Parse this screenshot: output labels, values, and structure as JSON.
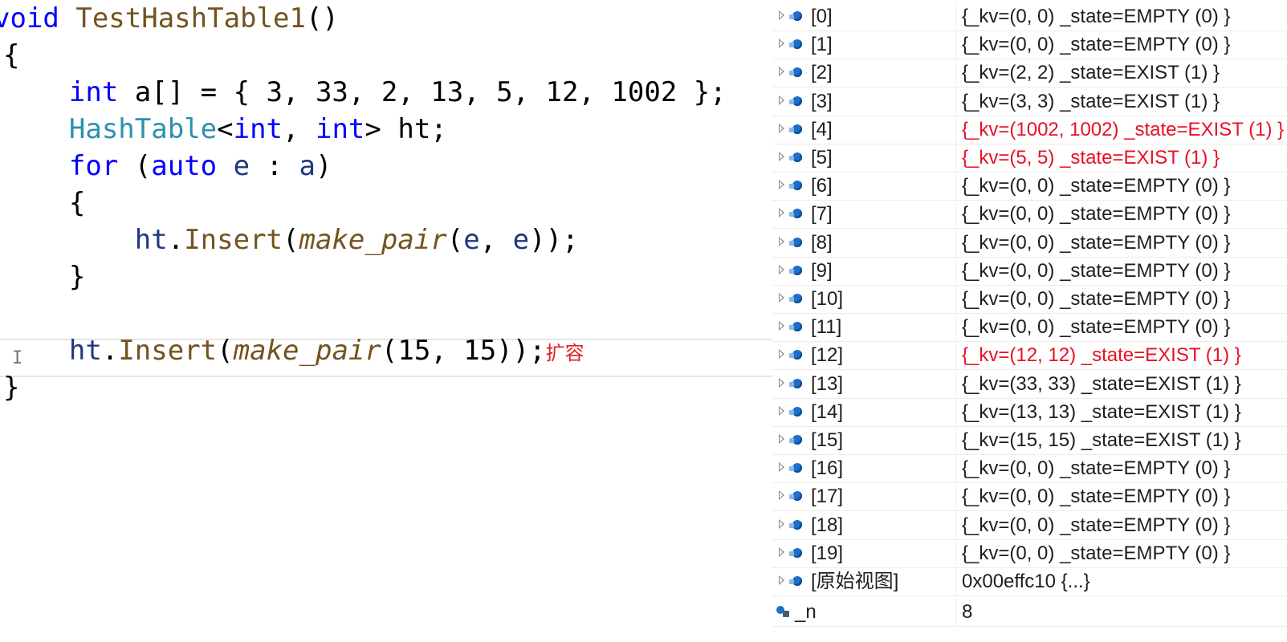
{
  "editor": {
    "lines": [
      {
        "tokens": [
          {
            "t": "void ",
            "c": "k-kw"
          },
          {
            "t": "TestHashTable1",
            "c": "k-fn"
          },
          {
            "t": "()",
            "c": "k-punc"
          }
        ]
      },
      {
        "tokens": [
          {
            "t": "{",
            "c": "k-punc"
          }
        ]
      },
      {
        "tokens": [
          {
            "t": "    ",
            "c": "k-punc"
          },
          {
            "t": "int",
            "c": "k-kw"
          },
          {
            "t": " a[] = { 3, 33, 2, 13, 5, 12, 1002 };",
            "c": "k-punc"
          }
        ]
      },
      {
        "tokens": [
          {
            "t": "    ",
            "c": "k-punc"
          },
          {
            "t": "HashTable",
            "c": "k-type"
          },
          {
            "t": "<",
            "c": "k-punc"
          },
          {
            "t": "int",
            "c": "k-kw"
          },
          {
            "t": ", ",
            "c": "k-punc"
          },
          {
            "t": "int",
            "c": "k-kw"
          },
          {
            "t": "> ht;",
            "c": "k-punc"
          }
        ]
      },
      {
        "tokens": [
          {
            "t": "    ",
            "c": "k-punc"
          },
          {
            "t": "for",
            "c": "k-kw"
          },
          {
            "t": " (",
            "c": "k-punc"
          },
          {
            "t": "auto",
            "c": "k-kw"
          },
          {
            "t": " ",
            "c": "k-punc"
          },
          {
            "t": "e",
            "c": "k-param"
          },
          {
            "t": " : ",
            "c": "k-punc"
          },
          {
            "t": "a",
            "c": "k-param"
          },
          {
            "t": ")",
            "c": "k-punc"
          }
        ]
      },
      {
        "tokens": [
          {
            "t": "    {",
            "c": "k-punc"
          }
        ]
      },
      {
        "tokens": [
          {
            "t": "        ",
            "c": "k-punc"
          },
          {
            "t": "ht",
            "c": "k-param"
          },
          {
            "t": ".",
            "c": "k-punc"
          },
          {
            "t": "Insert",
            "c": "k-fn"
          },
          {
            "t": "(",
            "c": "k-punc"
          },
          {
            "t": "make_pair",
            "c": "k-italic"
          },
          {
            "t": "(",
            "c": "k-punc"
          },
          {
            "t": "e",
            "c": "k-param"
          },
          {
            "t": ", ",
            "c": "k-punc"
          },
          {
            "t": "e",
            "c": "k-param"
          },
          {
            "t": "));",
            "c": "k-punc"
          }
        ]
      },
      {
        "tokens": [
          {
            "t": "    }",
            "c": "k-punc"
          }
        ]
      },
      {
        "tokens": []
      },
      {
        "tokens": [
          {
            "t": "    ",
            "c": "k-punc"
          },
          {
            "t": "ht",
            "c": "k-param"
          },
          {
            "t": ".",
            "c": "k-punc"
          },
          {
            "t": "Insert",
            "c": "k-fn"
          },
          {
            "t": "(",
            "c": "k-punc"
          },
          {
            "t": "make_pair",
            "c": "k-italic"
          },
          {
            "t": "(15, 15));",
            "c": "k-punc"
          },
          {
            "t": "扩容",
            "c": "annotation"
          }
        ]
      },
      {
        "tokens": [
          {
            "t": "}",
            "c": "k-punc"
          }
        ]
      }
    ]
  },
  "watch": {
    "rows": [
      {
        "name": "[0]",
        "value": "{_kv=(0, 0) _state=EMPTY (0) }",
        "changed": false
      },
      {
        "name": "[1]",
        "value": "{_kv=(0, 0) _state=EMPTY (0) }",
        "changed": false
      },
      {
        "name": "[2]",
        "value": "{_kv=(2, 2) _state=EXIST (1) }",
        "changed": false
      },
      {
        "name": "[3]",
        "value": "{_kv=(3, 3) _state=EXIST (1) }",
        "changed": false
      },
      {
        "name": "[4]",
        "value": "{_kv=(1002, 1002) _state=EXIST (1) }",
        "changed": true
      },
      {
        "name": "[5]",
        "value": "{_kv=(5, 5) _state=EXIST (1) }",
        "changed": true
      },
      {
        "name": "[6]",
        "value": "{_kv=(0, 0) _state=EMPTY (0) }",
        "changed": false
      },
      {
        "name": "[7]",
        "value": "{_kv=(0, 0) _state=EMPTY (0) }",
        "changed": false
      },
      {
        "name": "[8]",
        "value": "{_kv=(0, 0) _state=EMPTY (0) }",
        "changed": false
      },
      {
        "name": "[9]",
        "value": "{_kv=(0, 0) _state=EMPTY (0) }",
        "changed": false
      },
      {
        "name": "[10]",
        "value": "{_kv=(0, 0) _state=EMPTY (0) }",
        "changed": false
      },
      {
        "name": "[11]",
        "value": "{_kv=(0, 0) _state=EMPTY (0) }",
        "changed": false
      },
      {
        "name": "[12]",
        "value": "{_kv=(12, 12) _state=EXIST (1) }",
        "changed": true
      },
      {
        "name": "[13]",
        "value": "{_kv=(33, 33) _state=EXIST (1) }",
        "changed": false
      },
      {
        "name": "[14]",
        "value": "{_kv=(13, 13) _state=EXIST (1) }",
        "changed": false
      },
      {
        "name": "[15]",
        "value": "{_kv=(15, 15) _state=EXIST (1) }",
        "changed": false
      },
      {
        "name": "[16]",
        "value": "{_kv=(0, 0) _state=EMPTY (0) }",
        "changed": false
      },
      {
        "name": "[17]",
        "value": "{_kv=(0, 0) _state=EMPTY (0) }",
        "changed": false
      },
      {
        "name": "[18]",
        "value": "{_kv=(0, 0) _state=EMPTY (0) }",
        "changed": false
      },
      {
        "name": "[19]",
        "value": "{_kv=(0, 0) _state=EMPTY (0) }",
        "changed": false
      },
      {
        "name": "[原始视图]",
        "value": "0x00effc10 {...}",
        "changed": false
      }
    ],
    "member": {
      "name": "_n",
      "value": "8"
    }
  },
  "colors": {
    "changed_value": "#e81123",
    "keyword": "#0000ff",
    "function": "#74531f",
    "type": "#2b91af",
    "param": "#1f377f",
    "annotation": "#e02020"
  }
}
